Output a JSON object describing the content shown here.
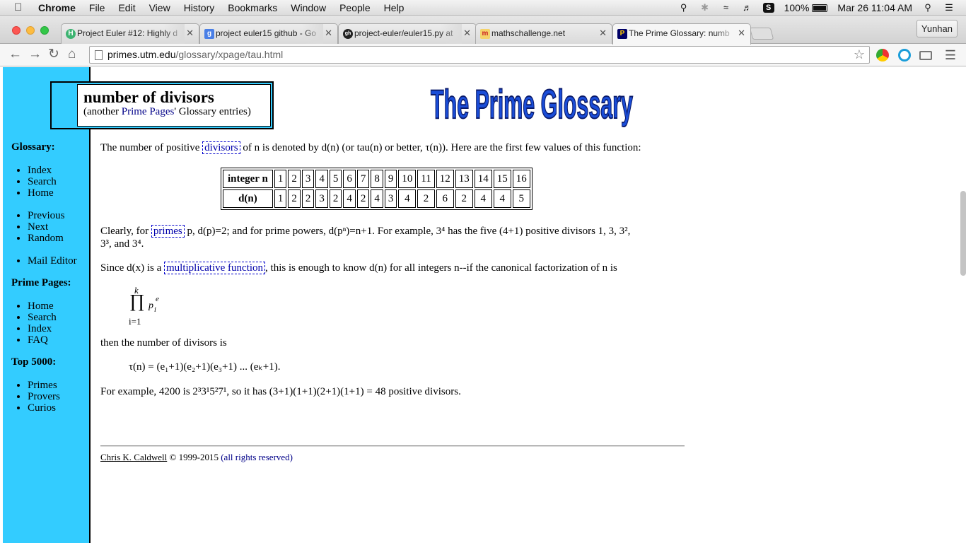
{
  "menubar": {
    "app": "Chrome",
    "menus": [
      "File",
      "Edit",
      "View",
      "History",
      "Bookmarks",
      "Window",
      "People",
      "Help"
    ],
    "battery": "100%",
    "clock": "Mar 26  11:04 AM"
  },
  "tabs": [
    {
      "title": "Project Euler #12: Highly d",
      "favicon": "H",
      "favicon_color": "#3cb371"
    },
    {
      "title": "project euler15 github - Go",
      "favicon": "g",
      "favicon_color": "#4a7fe6"
    },
    {
      "title": "project-euler/euler15.py at",
      "favicon": "gh",
      "favicon_color": "#222222"
    },
    {
      "title": "mathschallenge.net",
      "favicon": "m",
      "favicon_color": "#cc2222"
    },
    {
      "title": "The Prime Glossary: numb",
      "favicon": "P",
      "favicon_color": "#000066"
    }
  ],
  "profile": "Yunhan",
  "address": {
    "host": "primes.utm.edu",
    "path": "/glossary/xpage/tau.html"
  },
  "glossary_box": {
    "title": "number of divisors",
    "sub_prefix": "(another ",
    "sub_link": "Prime Pages",
    "sub_suffix": "' Glossary entries)"
  },
  "logo_text": "The Prime Glossary",
  "sidebar": {
    "glossary_heading": "Glossary:",
    "glossary_links": [
      "Index",
      "Search",
      "Home"
    ],
    "nav_links": [
      "Previous",
      "Next",
      "Random"
    ],
    "mail_link": "Mail Editor",
    "prime_pages_heading": "Prime Pages:",
    "prime_pages_links": [
      "Home",
      "Search",
      "Index",
      "FAQ"
    ],
    "top_heading": "Top 5000:",
    "top_links": [
      "Primes",
      "Provers",
      "Curios"
    ]
  },
  "table": {
    "row1_header": "integer n",
    "row2_header": "d(n)",
    "n": [
      "1",
      "2",
      "3",
      "4",
      "5",
      "6",
      "7",
      "8",
      "9",
      "10",
      "11",
      "12",
      "13",
      "14",
      "15",
      "16"
    ],
    "d": [
      "1",
      "2",
      "2",
      "3",
      "2",
      "4",
      "2",
      "4",
      "3",
      "4",
      "2",
      "6",
      "2",
      "4",
      "4",
      "5"
    ]
  },
  "paragraphs": {
    "p1_a": "The number of positive ",
    "p1_link": "divisors",
    "p1_b": " of n is denoted by d(n) (or tau(n) or better, τ(n)). Here are the first few values of this function:",
    "p2_a": "Clearly, for ",
    "p2_link": "primes",
    "p2_b": " p, d(p)=2; and for prime powers, d(pⁿ)=n+1. For example, 3⁴ has the five (4+1) positive divisors 1, 3, 3²,",
    "p2_c": "3³, and 3⁴.",
    "p3_a": "Since d(x) is a ",
    "p3_link": "multiplicative function",
    "p3_b": ", this is enough to know d(n) for all integers n--if the canonical factorization of n is",
    "p4": "then the number of divisors is",
    "formula": "τ(n) = (e₁+1)(e₂+1)(e₃+1) ... (eₖ+1).",
    "p5": "For example, 4200 is 2³3¹5²7¹, so it has (3+1)(1+1)(2+1)(1+1) = 48 positive divisors."
  },
  "product": {
    "upper": "k",
    "symbol": "∏",
    "lower": "i=1",
    "base": "p",
    "sub": "i",
    "exp": "e"
  },
  "footer": {
    "author": "Chris K. Caldwell",
    "years": " © 1999-2015 ",
    "rights": "(all rights reserved)"
  }
}
